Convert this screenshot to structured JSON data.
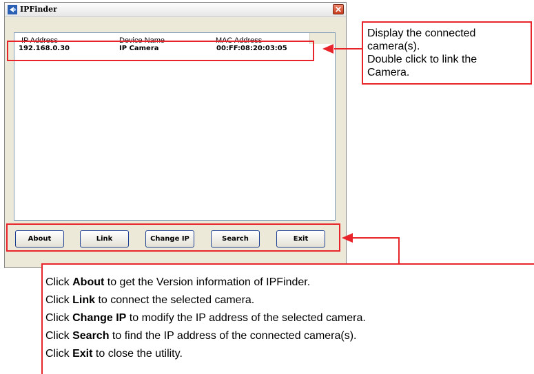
{
  "window": {
    "title": "IPFinder",
    "close_glyph": "✕"
  },
  "listview": {
    "columns": [
      "IP Address",
      "Device Name",
      "MAC Address"
    ],
    "rows": [
      {
        "ip": "192.168.0.30",
        "device": "IP Camera",
        "mac": "00:FF:08:20:03:05"
      }
    ]
  },
  "buttons": {
    "about": "About",
    "link": "Link",
    "change_ip": "Change IP",
    "search": "Search",
    "exit": "Exit"
  },
  "callouts": {
    "list": {
      "line1": "Display the connected",
      "line2": "camera(s).",
      "line3": "Double click to link the",
      "line4": "Camera."
    },
    "buttons": [
      {
        "pre": "Click ",
        "bold": "About",
        "post": " to get the Version information of IPFinder."
      },
      {
        "pre": "Click ",
        "bold": "Link",
        "post": " to connect the selected camera."
      },
      {
        "pre": "Click ",
        "bold": "Change IP",
        "post": " to modify the IP address of the selected camera."
      },
      {
        "pre": "Click ",
        "bold": "Search",
        "post": " to find the IP address of the connected camera(s)."
      },
      {
        "pre": "Click ",
        "bold": "Exit",
        "post": " to close the utility."
      }
    ]
  },
  "colors": {
    "annotation_red": "#e8232a",
    "window_bg": "#ece9d8",
    "button_border": "#1c3f94"
  }
}
